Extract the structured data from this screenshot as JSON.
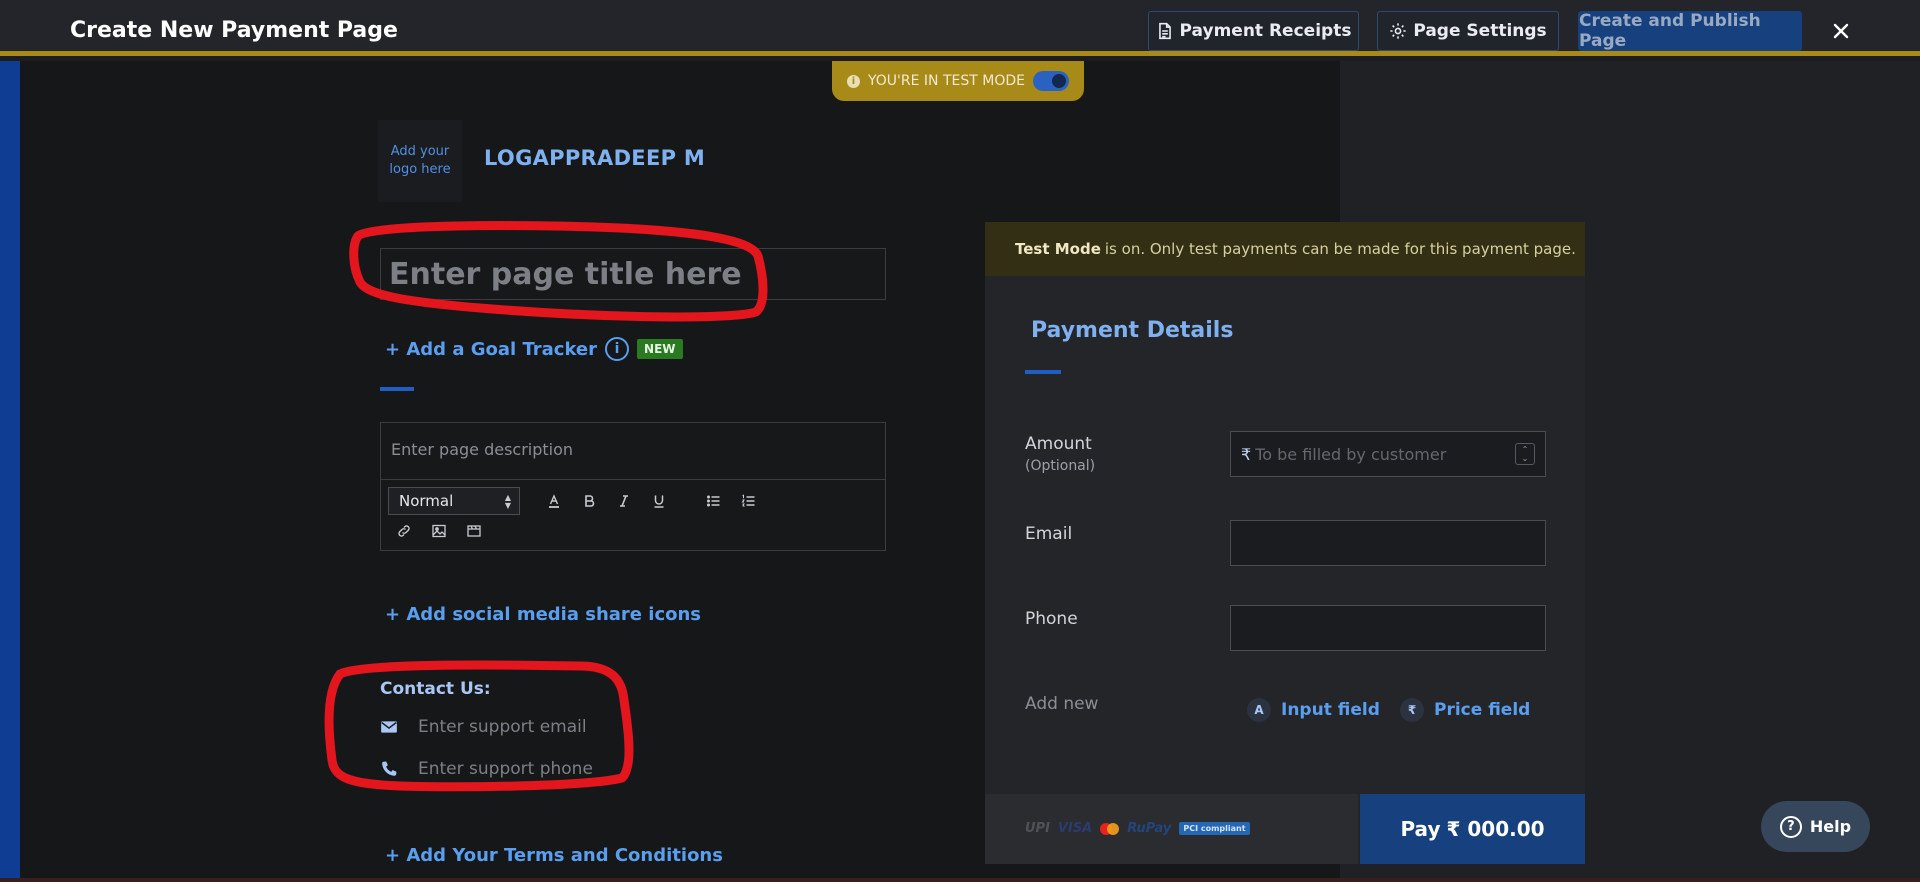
{
  "header": {
    "title": "Create New Payment Page",
    "receipts_label": "Payment Receipts",
    "settings_label": "Page Settings",
    "publish_label": "Create and Publish Page",
    "close_icon": "×"
  },
  "test_mode": {
    "pill_text": "YOU'RE IN TEST MODE",
    "toggle_on": true
  },
  "editor": {
    "logo_placeholder": "Add your logo here",
    "brand_name": "LOGAPPRADEEP M",
    "title_placeholder": "Enter page title here",
    "goal_tracker_label": "+ Add a Goal Tracker",
    "new_badge": "NEW",
    "description_placeholder": "Enter page description",
    "text_style": "Normal",
    "social_label": "+ Add social media share icons",
    "contact_title": "Contact Us:",
    "support_email_placeholder": "Enter support email",
    "support_phone_placeholder": "Enter support phone",
    "terms_label": "+ Add Your Terms and Conditions"
  },
  "payment_panel": {
    "banner_bold": "Test Mode",
    "banner_text": "is on. Only test payments can be made for this payment page.",
    "title": "Payment Details",
    "amount_label": "Amount",
    "amount_sublabel": "(Optional)",
    "currency_symbol": "₹",
    "amount_placeholder": "To be filled by customer",
    "email_label": "Email",
    "phone_label": "Phone",
    "add_new_label": "Add new",
    "input_field_label": "Input field",
    "price_field_label": "Price field",
    "pay_prefix": "Pay",
    "pay_amount": "₹ 000.00",
    "payment_logos": [
      "UPI",
      "VISA",
      "mastercard",
      "RuPay",
      "PCI compliant"
    ]
  },
  "help": {
    "label": "Help"
  },
  "colors": {
    "accent_blue": "#17407e",
    "link_blue": "#5a9ef0",
    "test_mode_gold": "#a88a19",
    "annotation_red": "#e3151d"
  }
}
